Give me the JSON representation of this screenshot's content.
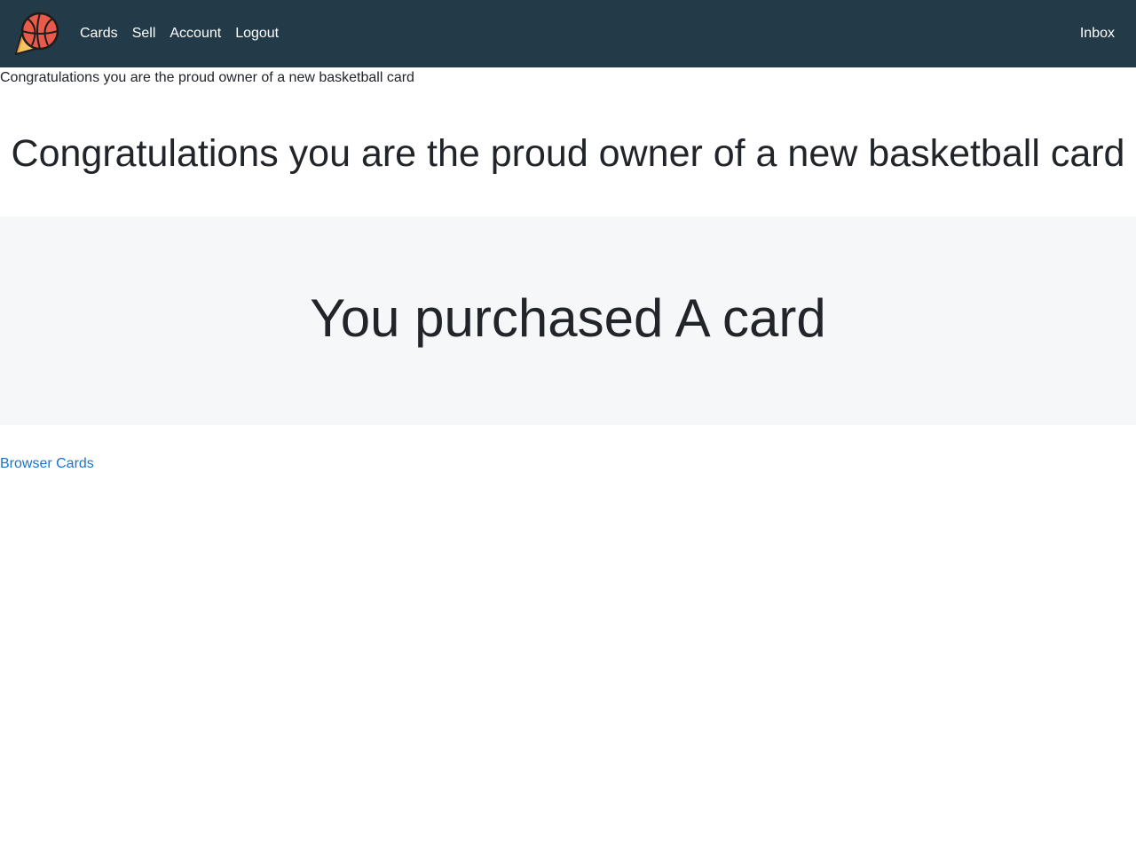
{
  "nav": {
    "logo_icon": "basketball-logo-icon",
    "links": [
      {
        "label": "Cards"
      },
      {
        "label": "Sell"
      },
      {
        "label": "Account"
      },
      {
        "label": "Logout"
      }
    ],
    "inbox_label": "Inbox"
  },
  "flash_message": "Congratulations you are the proud owner of a new basketball card",
  "page_title": "Congratulations you are the proud owner of a new basketball card",
  "jumbotron": {
    "text": "You purchased A card"
  },
  "browse_link": "Browser Cards",
  "colors": {
    "navbar_bg": "#233a48",
    "jumbotron_bg": "#f6f7f9",
    "link": "#1a74c9",
    "text": "#212529"
  }
}
